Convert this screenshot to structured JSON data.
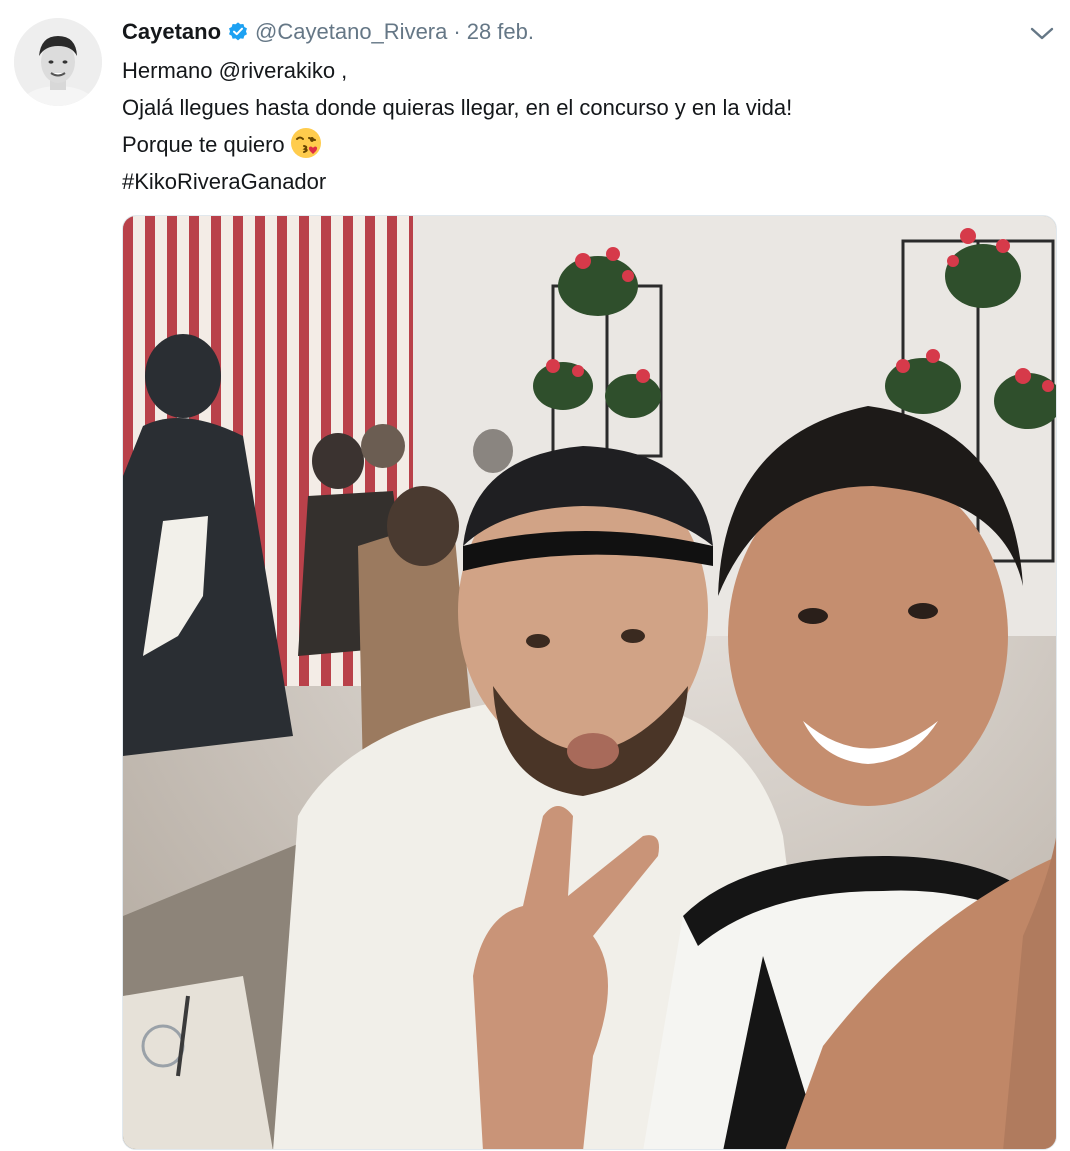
{
  "tweet": {
    "author": {
      "display_name": "Cayetano",
      "handle": "@Cayetano_Rivera",
      "verified": true,
      "avatar_icon": "profile-photo"
    },
    "separator": "·",
    "timestamp": "28 feb.",
    "menu_icon": "chevron-down-icon",
    "text": {
      "line1_prefix": "Hermano ",
      "line1_mention": "@riverakiko",
      "line1_suffix": " ,",
      "line2": "Ojalá llegues hasta donde quieras llegar, en el concurso y en la vida!",
      "line3": "Porque te quiero",
      "line3_emoji": "face-blowing-a-kiss-emoji",
      "line4_hashtag": "#KikoRiveraGanador"
    },
    "media": {
      "type": "photo",
      "subject": "selfie-two-men-at-fair-tent"
    }
  },
  "colors": {
    "text_primary": "#14171a",
    "text_secondary": "#657786",
    "verified_blue": "#1da1f2",
    "border": "#e1e8ed"
  }
}
